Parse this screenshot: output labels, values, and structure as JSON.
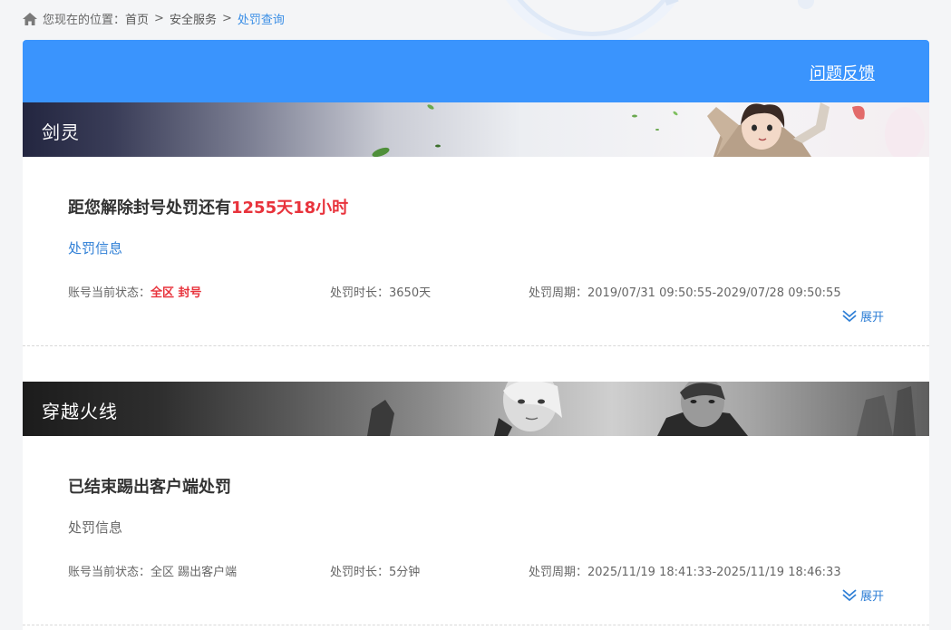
{
  "breadcrumb": {
    "prefix": "您现在的位置：",
    "items": [
      "首页",
      "安全服务"
    ],
    "current": "处罚查询",
    "separator": ">"
  },
  "header": {
    "feedback_label": "问题反馈",
    "color": "#3a94fd"
  },
  "sections": [
    {
      "game": "剑灵",
      "headline_prefix": "距您解除封号处罚还有",
      "headline_highlight": "1255天18小时",
      "info_title": "处罚信息",
      "status_label": "账号当前状态：",
      "status_value": "全区 封号",
      "duration_label": "处罚时长：",
      "duration_value": "3650天",
      "period_label": "处罚周期：",
      "period_value": "2019/07/31 09:50:55-2029/07/28 09:50:55",
      "expand_label": "展开"
    },
    {
      "game": "穿越火线",
      "headline_prefix": "已结束踢出客户端处罚",
      "info_title": "处罚信息",
      "status_label": "账号当前状态：",
      "status_value": "全区 踢出客户端",
      "duration_label": "处罚时长：",
      "duration_value": "5分钟",
      "period_label": "处罚周期：",
      "period_value": "2025/11/19 18:41:33-2025/11/19 18:46:33",
      "expand_label": "展开"
    }
  ],
  "colors": {
    "accent_red": "#e8333c",
    "link_blue": "#2f7fd6"
  }
}
